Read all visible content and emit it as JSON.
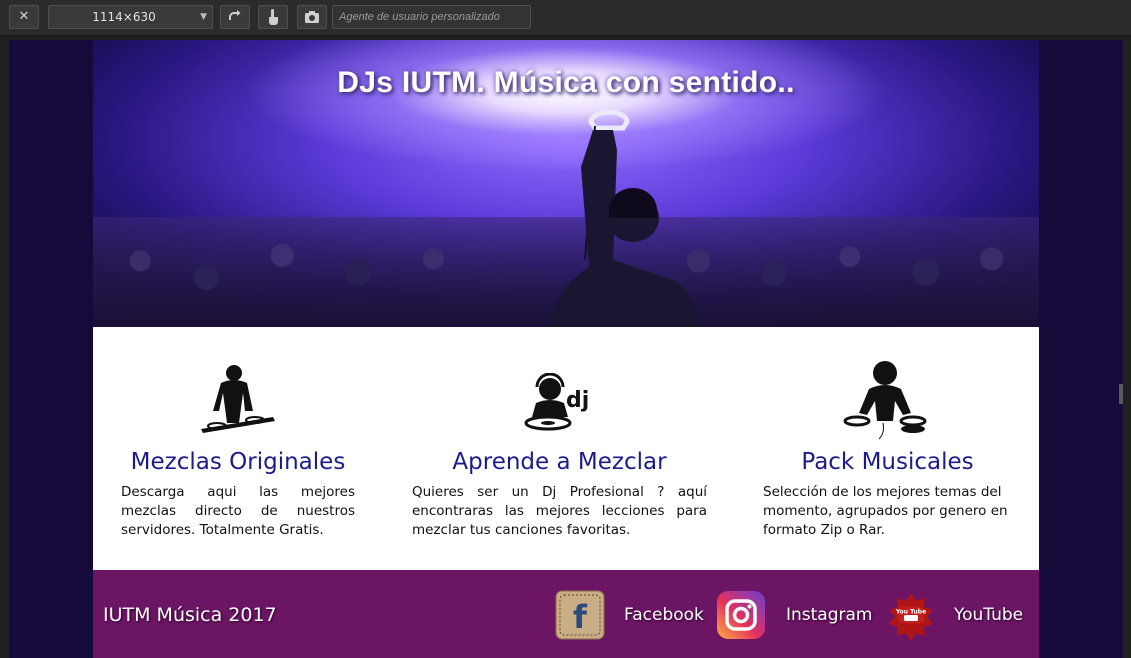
{
  "toolbar": {
    "close_icon": "close-icon",
    "size_value": "1114×630",
    "rotate_icon": "rotate-icon",
    "touch_icon": "touch-icon",
    "screenshot_icon": "camera-icon",
    "user_agent_placeholder": "Agente de usuario personalizado"
  },
  "hero": {
    "title": "DJs IUTM. Música con sentido.."
  },
  "features": [
    {
      "icon": "dj-mixer-icon",
      "title": "Mezclas Originales",
      "text": "Descarga aqui las mejores mezclas directo de nuestros servidores. Totalmente Gratis."
    },
    {
      "icon": "dj-headphones-icon",
      "icon_text": "dj",
      "title": "Aprende a Mezclar",
      "text": "Quieres ser un Dj Profesional ? aquí encontraras las mejores lecciones para mezclar tus canciones favoritas."
    },
    {
      "icon": "dj-turntables-icon",
      "title": "Pack Musicales",
      "text": "Selección de los mejores temas del momento, agrupados por genero en formato Zip o Rar."
    }
  ],
  "footer": {
    "brand": "IUTM Música 2017",
    "social": [
      {
        "name": "Facebook",
        "icon": "facebook-icon",
        "glyph": "f"
      },
      {
        "name": "Instagram",
        "icon": "instagram-icon"
      },
      {
        "name": "YouTube",
        "icon": "youtube-icon",
        "badge": "You Tube"
      }
    ]
  },
  "colors": {
    "toolbar_bg": "#2b2b2b",
    "viewport_bg": "#160a3a",
    "feature_title": "#1b1b8c",
    "footer_bg": "#6c1565"
  }
}
